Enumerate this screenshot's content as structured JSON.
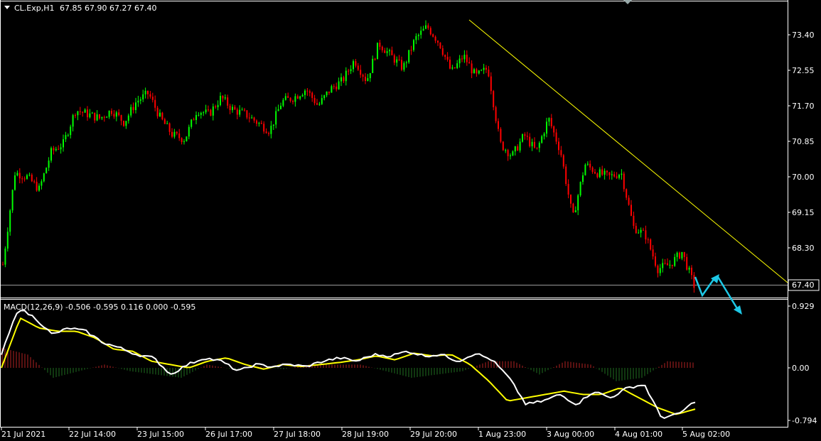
{
  "header": {
    "symbol_label": "CL.Exp,H1",
    "ohlc_label": "67.85 67.90 67.27 67.40"
  },
  "macd": {
    "label": "MACD(12,26,9) -0.506 -0.595 0.116 0.000 -0.595"
  },
  "colors": {
    "background": "#000000",
    "bull": "#00ff00",
    "bear": "#ff0000",
    "trendline": "#ffff00",
    "arrow": "#1ec8e6",
    "macd_main": "#ffffff",
    "macd_signal": "#ffff00",
    "hist_pos": "#b22222",
    "hist_neg": "#1f6e1f",
    "grid": "#ffffff"
  },
  "chart_data": [
    {
      "type": "candlestick",
      "title": "CL.Exp,H1",
      "price_axis_ticks": [
        "73.40",
        "72.55",
        "71.70",
        "70.85",
        "70.00",
        "69.15",
        "68.30"
      ],
      "current_price": "67.40",
      "ylim": [
        67.2,
        74.0
      ],
      "time_axis_ticks": [
        "21 Jul 2021",
        "22 Jul 14:00",
        "23 Jul 15:00",
        "26 Jul 17:00",
        "27 Jul 18:00",
        "28 Jul 19:00",
        "29 Jul 20:00",
        "1 Aug 23:00",
        "3 Aug 00:00",
        "4 Aug 01:00",
        "5 Aug 02:00"
      ],
      "close_path": [
        67.9,
        70.1,
        70.0,
        69.7,
        70.6,
        70.8,
        71.6,
        71.5,
        71.4,
        71.6,
        71.3,
        71.8,
        72.0,
        71.4,
        71.0,
        70.9,
        71.6,
        71.5,
        71.9,
        71.6,
        71.5,
        71.3,
        71.1,
        71.8,
        71.9,
        72.1,
        71.7,
        72.1,
        72.3,
        72.8,
        72.3,
        73.2,
        72.9,
        72.6,
        73.3,
        73.6,
        73.2,
        72.5,
        72.9,
        72.4,
        72.6,
        70.8,
        70.5,
        71.0,
        70.6,
        71.4,
        70.6,
        69.0,
        70.3,
        70.1,
        70.0,
        70.1,
        68.8,
        68.6,
        67.8,
        67.9,
        68.2,
        67.4
      ],
      "trendline": {
        "from": [
          "29 Jul 20:00",
          73.8
        ],
        "to": [
          "5 Aug 02:00",
          67.5
        ]
      },
      "forecast_arrows": [
        [
          67.3,
          67.9
        ],
        [
          67.9,
          66.8
        ]
      ]
    },
    {
      "type": "line",
      "title": "MACD(12,26,9)",
      "axis_ticks": [
        "0.929",
        "0.00",
        "-0.794"
      ],
      "ylim": [
        -0.86,
        1.0
      ],
      "series": [
        {
          "name": "MACD",
          "values": [
            0.2,
            0.9,
            0.75,
            0.5,
            0.6,
            0.55,
            0.38,
            0.3,
            0.2,
            0.15,
            -0.1,
            0.05,
            0.15,
            0.1,
            -0.05,
            0.05,
            0.02,
            0.05,
            0.02,
            0.1,
            0.15,
            0.1,
            0.2,
            0.18,
            0.25,
            0.18,
            0.2,
            0.1,
            0.22,
            0.12,
            -0.15,
            -0.55,
            -0.5,
            -0.4,
            -0.55,
            -0.35,
            -0.45,
            -0.3,
            -0.25,
            -0.75,
            -0.7,
            -0.5
          ]
        },
        {
          "name": "Signal",
          "values": [
            0.0,
            0.75,
            0.6,
            0.55,
            0.55,
            0.45,
            0.28,
            0.25,
            0.1,
            0.05,
            0.0,
            0.1,
            0.15,
            0.05,
            -0.02,
            0.05,
            0.02,
            0.05,
            0.08,
            0.12,
            0.18,
            0.12,
            0.22,
            0.18,
            0.2,
            0.05,
            -0.2,
            -0.5,
            -0.45,
            -0.4,
            -0.35,
            -0.4,
            -0.4,
            -0.3,
            -0.45,
            -0.6,
            -0.7,
            -0.62
          ]
        },
        {
          "name": "Histogram",
          "values": [
            0.3,
            0.2,
            -0.15,
            -0.05,
            0.05,
            -0.05,
            -0.1,
            -0.15,
            0.05,
            -0.02,
            0.02,
            -0.02,
            0.05,
            0.05,
            0.05,
            -0.05,
            -0.15,
            -0.1,
            -0.05,
            0.1,
            0.1,
            -0.1,
            0.1,
            0.05,
            -0.2,
            -0.15,
            0.1,
            0.08
          ]
        }
      ]
    }
  ]
}
